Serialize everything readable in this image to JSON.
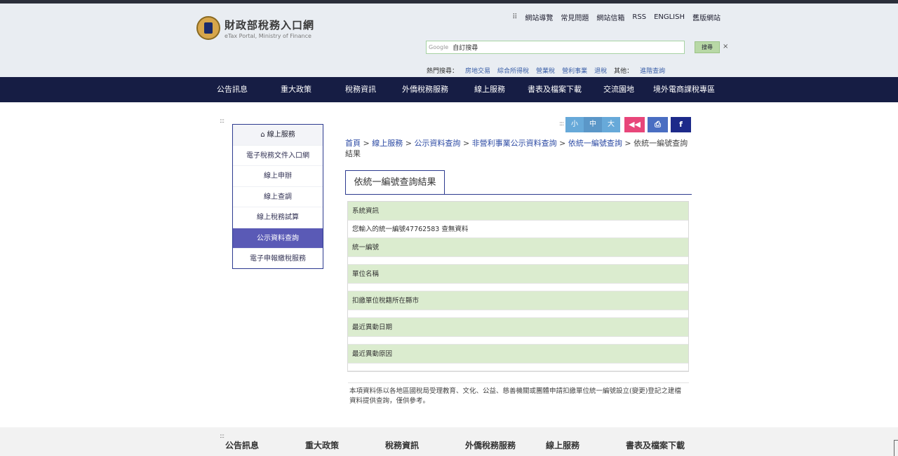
{
  "header": {
    "logo_title": "財政部稅務入口網",
    "logo_subtitle": "eTax Portal, Ministry of Finance",
    "top_links": [
      "網站導覽",
      "常見問題",
      "網站信箱",
      "RSS",
      "ENGLISH",
      "舊版網站"
    ],
    "search_brand": "Google",
    "search_placeholder": "自訂搜尋",
    "search_button": "搜尋",
    "search_clear": "×",
    "hot_label": "熱門搜尋：",
    "hot_links": [
      "房地交易",
      "綜合所得稅",
      "營業稅",
      "營利事業",
      "退稅"
    ],
    "other_label": "其他：",
    "other_link": "進階查詢"
  },
  "nav": [
    "公告訊息",
    "重大政策",
    "稅務資訊",
    "外僑稅務服務",
    "線上服務",
    "書表及檔案下載",
    "交流園地",
    "境外電商課稅專區"
  ],
  "grip": ":::",
  "sidebar": {
    "title": "線上服務",
    "items": [
      "電子稅務文件入口網",
      "線上申辦",
      "線上查調",
      "線上稅務試算",
      "公示資料查詢",
      "電子申報繳稅服務"
    ],
    "active_index": 4
  },
  "font_controls": [
    "小",
    "中",
    "大"
  ],
  "action_icons": [
    "back-icon",
    "print-icon",
    "facebook-icon"
  ],
  "action_glyphs": [
    "◀◀",
    "⎙",
    "f"
  ],
  "breadcrumb": {
    "links": [
      "首頁",
      "線上服務",
      "公示資料查詢",
      "非營利事業公示資料查詢",
      "依統一編號查詢"
    ],
    "separator": ">",
    "current": "依統一編號查詢結果"
  },
  "tab_label": "依統一編號查詢結果",
  "result": {
    "rows": [
      {
        "label": "系統資訊",
        "value": "您輸入的統一編號47762583 查無資料"
      },
      {
        "label": "統一編號",
        "value": ""
      },
      {
        "label": "單位名稱",
        "value": ""
      },
      {
        "label": "扣繳單位稅籍所在縣市",
        "value": ""
      },
      {
        "label": "最近異動日期",
        "value": ""
      },
      {
        "label": "最近異動原因",
        "value": ""
      }
    ]
  },
  "note": "本項資料係以各地區國稅局受理教育、文化、公益、慈善機關或團體申請扣繳單位統一編號設立(變更)登記之建檔資料提供查詢，僅供參考。",
  "footer_nav": [
    "公告訊息",
    "重大政策",
    "稅務資訊",
    "外僑稅務服務",
    "線上服務",
    "書表及檔案下載"
  ],
  "colors": {
    "nav_bg": "#161d44",
    "active_side": "#5a5ab6",
    "row_header": "#dbeccf",
    "facebook": "#1d2a8a",
    "back": "#e8467a",
    "print": "#4a6ec2"
  }
}
